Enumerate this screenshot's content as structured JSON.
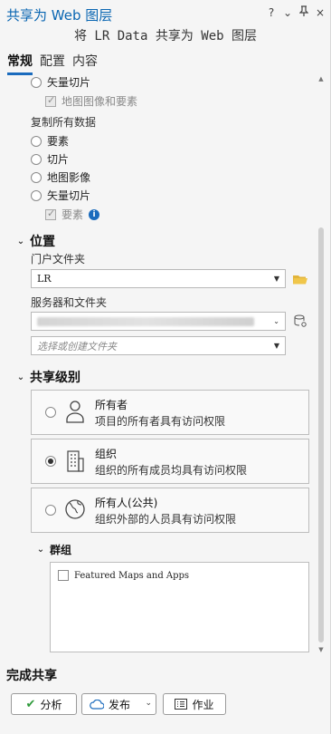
{
  "window": {
    "title": "共享为 Web 图层",
    "subtitle": "将 LR Data 共享为 Web 图层",
    "controls": [
      "?",
      "⌄",
      "⊼",
      "×"
    ]
  },
  "tabs": [
    {
      "label": "常规",
      "active": true
    },
    {
      "label": "配置",
      "active": false
    },
    {
      "label": "内容",
      "active": false
    }
  ],
  "top_options": {
    "vector_tile_label": "矢量切片",
    "map_image_features_label": "地图图像和要素"
  },
  "copy_all_data": {
    "heading": "复制所有数据",
    "options": [
      "要素",
      "切片",
      "地图影像",
      "矢量切片"
    ],
    "features_check_label": "要素"
  },
  "location": {
    "heading": "位置",
    "portal_folder_label": "门户文件夹",
    "portal_folder_value": "LR",
    "server_folder_label": "服务器和文件夹",
    "server_value": "",
    "folder_placeholder": "选择或创建文件夹"
  },
  "sharing": {
    "heading": "共享级别",
    "levels": [
      {
        "title": "所有者",
        "desc": "项目的所有者具有访问权限",
        "selected": false,
        "icon": "person-icon"
      },
      {
        "title": "组织",
        "desc": "组织的所有成员均具有访问权限",
        "selected": true,
        "icon": "building-icon"
      },
      {
        "title": "所有人(公共)",
        "desc": "组织外部的人员具有访问权限",
        "selected": false,
        "icon": "globe-icon"
      }
    ],
    "groups_heading": "群组",
    "groups": [
      {
        "name": "Featured Maps and Apps",
        "checked": false
      }
    ]
  },
  "footer": {
    "heading": "完成共享",
    "analyze_label": "分析",
    "publish_label": "发布",
    "jobs_label": "作业"
  },
  "colors": {
    "accent": "#1a6bbd",
    "title": "#0a66b2",
    "analyze_check": "#2e9a3a"
  }
}
